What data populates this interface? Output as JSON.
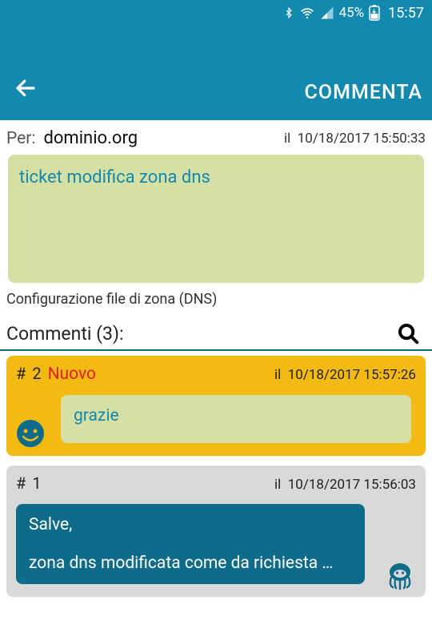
{
  "statusbar": {
    "battery": "45%",
    "time": "15:57"
  },
  "appbar": {
    "title": "COMMENTA"
  },
  "header": {
    "per_label": "Per:",
    "domain": "dominio.org",
    "ts_prefix": "il",
    "ts": "10/18/2017 15:50:33"
  },
  "ticket": {
    "subject": "ticket modifica zona dns",
    "category": "Configurazione file di zona (DNS)"
  },
  "comments": {
    "heading": "Commenti (3):",
    "items": [
      {
        "hash": "#",
        "num": "2",
        "new_label": "Nuovo",
        "is_new": true,
        "ts_prefix": "il",
        "ts": "10/18/2017 15:57:26",
        "body": "grazie"
      },
      {
        "hash": "#",
        "num": "1",
        "is_new": false,
        "ts_prefix": "il",
        "ts": "10/18/2017 15:56:03",
        "body": "Salve,\n\nzona dns modificata come da richiesta …"
      }
    ]
  }
}
